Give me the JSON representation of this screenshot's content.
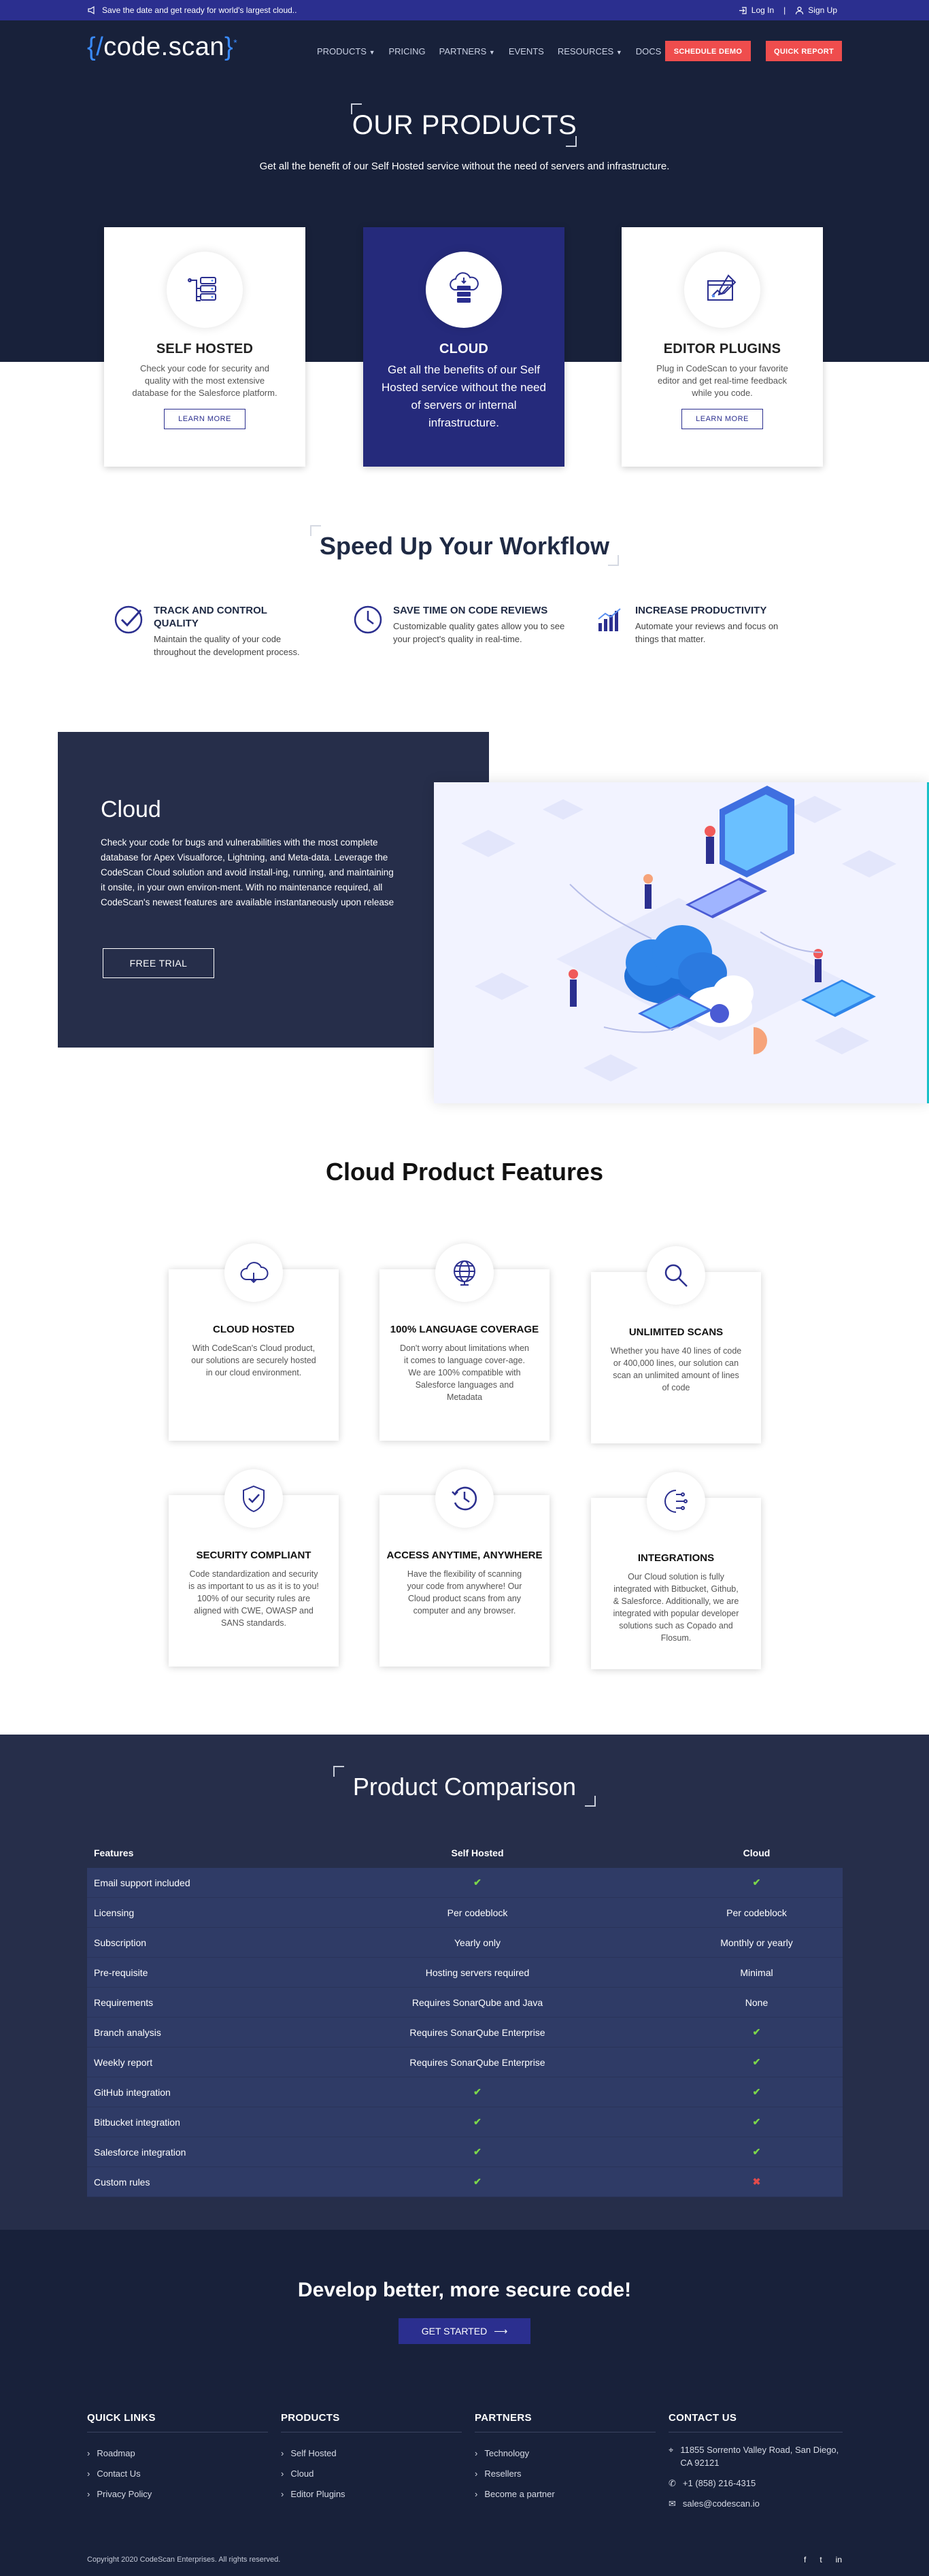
{
  "topbar": {
    "announcement": "Save the date and get ready for world's largest cloud..",
    "login": "Log In",
    "signup": "Sign Up"
  },
  "nav": {
    "logo": {
      "brace_open": "{/",
      "text": "code.scan",
      "brace_close": "}",
      "mark": "*"
    },
    "menu": [
      "PRODUCTS",
      "PRICING",
      "PARTNERS",
      "EVENTS",
      "RESOURCES",
      "DOCS"
    ],
    "schedule_demo": "SCHEDULE DEMO",
    "quick_report": "QUICK REPORT"
  },
  "hero": {
    "title": "OUR PRODUCTS",
    "subtitle": "Get all the benefit of our Self Hosted service without the need of servers and infrastructure.",
    "cards": [
      {
        "title": "SELF HOSTED",
        "text": "Check your code for security and quality with the most extensive database for the Salesforce platform.",
        "button": "LEARN MORE"
      },
      {
        "title": "CLOUD",
        "text": "Get all the benefits of our Self Hosted service without the need of servers or internal infrastructure."
      },
      {
        "title": "EDITOR PLUGINS",
        "text": "Plug in CodeScan to your favorite editor and get real-time feedback while you code.",
        "button": "LEARN MORE"
      }
    ]
  },
  "workflow": {
    "title": "Speed Up Your Workflow",
    "items": [
      {
        "title": "TRACK AND CONTROL QUALITY",
        "text": "Maintain the quality of your code throughout the development process."
      },
      {
        "title": "SAVE TIME ON CODE REVIEWS",
        "text": "Customizable quality gates allow you to see your project's quality in real-time."
      },
      {
        "title": "INCREASE PRODUCTIVITY",
        "text": "Automate your reviews and focus on things that matter."
      }
    ]
  },
  "cloud": {
    "title": "Cloud",
    "text": "Check your code for bugs and vulnerabilities with the most complete database for Apex Visualforce, Lightning, and Meta-data. Leverage the CodeScan Cloud solution and avoid install-ing, running, and maintaining it onsite, in your own environ-ment. With no maintenance required, all CodeScan's newest features are available instantaneously upon release",
    "button": "FREE TRIAL"
  },
  "features": {
    "title": "Cloud Product Features",
    "cards": [
      {
        "title": "CLOUD HOSTED",
        "text": "With CodeScan's Cloud product, our solutions are securely hosted in our cloud environment.",
        "icon": "cloud-icon"
      },
      {
        "title": "100% LANGUAGE COVERAGE",
        "text": "Don't worry about limitations when it comes to language cover-age. We are 100% compatible with Salesforce languages and Metadata",
        "icon": "globe-icon"
      },
      {
        "title": "UNLIMITED SCANS",
        "text": "Whether you have 40 lines of code or 400,000 lines, our solution can scan an unlimited amount of lines of code",
        "icon": "magnifier-icon"
      },
      {
        "title": "SECURITY COMPLIANT",
        "text": "Code standardization and security is as important to us as it is to you! 100% of our security rules are aligned with CWE, OWASP and SANS standards.",
        "icon": "shield-icon"
      },
      {
        "title": "ACCESS ANYTIME, ANYWHERE",
        "text": "Have the flexibility of scanning your code from anywhere! Our Cloud product scans from any computer and any browser.",
        "icon": "clock-icon"
      },
      {
        "title": "INTEGRATIONS",
        "text": "Our Cloud solution is fully integrated with Bitbucket, Github, & Salesforce. Additionally, we are integrated with popular developer solutions such as Copado and Flosum.",
        "icon": "integration-icon"
      }
    ]
  },
  "comparison": {
    "title": "Product Comparison",
    "headers": [
      "Features",
      "Self Hosted",
      "Cloud"
    ],
    "rows": [
      [
        "Email support included",
        "✔",
        "✔"
      ],
      [
        "Licensing",
        "Per codeblock",
        "Per codeblock"
      ],
      [
        "Subscription",
        "Yearly only",
        "Monthly or yearly"
      ],
      [
        "Pre-requisite",
        "Hosting servers required",
        "Minimal"
      ],
      [
        "Requirements",
        "Requires SonarQube and Java",
        "None"
      ],
      [
        "Branch analysis",
        "Requires SonarQube Enterprise",
        "✔"
      ],
      [
        "Weekly report",
        "Requires SonarQube Enterprise",
        "✔"
      ],
      [
        "GitHub integration",
        "✔",
        "✔"
      ],
      [
        "Bitbucket integration",
        "✔",
        "✔"
      ],
      [
        "Salesforce integration",
        "✔",
        "✔"
      ],
      [
        "Custom rules",
        "✔",
        "✖"
      ]
    ]
  },
  "cta": {
    "title": "Develop better, more secure code!",
    "button": "GET STARTED"
  },
  "footer": {
    "quick_links": {
      "title": "QUICK LINKS",
      "items": [
        "Roadmap",
        "Contact Us",
        "Privacy Policy"
      ]
    },
    "products": {
      "title": "PRODUCTS",
      "items": [
        "Self Hosted",
        "Cloud",
        "Editor Plugins"
      ]
    },
    "partners": {
      "title": "PARTNERS",
      "items": [
        "Technology",
        "Resellers",
        "Become a partner"
      ]
    },
    "contact": {
      "title": "CONTACT US",
      "address": "11855 Sorrento Valley Road, San Diego, CA 92121",
      "phone": "+1 (858) 216-4315",
      "email": "sales@codescan.io"
    },
    "copyright": "Copyright 2020 CodeScan Enterprises. All rights reserved.",
    "social": [
      "f",
      "t",
      "in"
    ]
  },
  "colors": {
    "navy": "#18213a",
    "accent": "#2b2f8f",
    "red": "#ef4d4d",
    "check": "#7bd64a"
  }
}
